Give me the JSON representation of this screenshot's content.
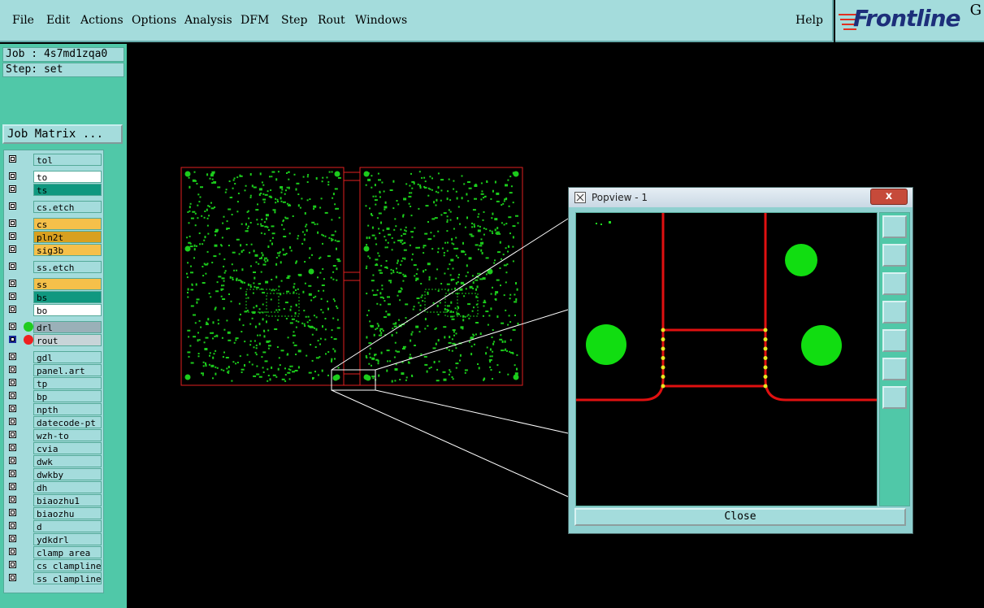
{
  "menu": {
    "items": [
      "File",
      "Edit",
      "Actions",
      "Options",
      "Analysis",
      "DFM",
      "Step",
      "Rout",
      "Windows"
    ],
    "help": "Help"
  },
  "logo": {
    "text": "Frontline",
    "corner": "G"
  },
  "job": {
    "label": "Job : 4s7md1zqa0",
    "step": "Step: set",
    "matrix_button": "Job Matrix ..."
  },
  "layers": [
    {
      "name": "tol",
      "color": "#a4dcdc"
    },
    {
      "name": "to",
      "color": "#ffffff"
    },
    {
      "name": "ts",
      "color": "#109880"
    },
    {
      "name": "cs.etch",
      "color": "#a4dcdc"
    },
    {
      "name": "cs",
      "color": "#f5c04a"
    },
    {
      "name": "pln2t",
      "color": "#d8a020"
    },
    {
      "name": "sig3b",
      "color": "#f5c04a"
    },
    {
      "name": "ss.etch",
      "color": "#a4dcdc"
    },
    {
      "name": "ss",
      "color": "#f5c04a"
    },
    {
      "name": "bs",
      "color": "#109880"
    },
    {
      "name": "bo",
      "color": "#ffffff"
    },
    {
      "name": "drl",
      "color": "#9ab0b8",
      "dot": "#20cc20"
    },
    {
      "name": "rout",
      "color": "#c8d4d8",
      "dot": "#ee2020",
      "active": true
    },
    {
      "name": "gdl",
      "color": "#a4dcdc"
    },
    {
      "name": "panel.art",
      "color": "#a4dcdc"
    },
    {
      "name": "tp",
      "color": "#a4dcdc"
    },
    {
      "name": "bp",
      "color": "#a4dcdc"
    },
    {
      "name": "npth",
      "color": "#a4dcdc"
    },
    {
      "name": "datecode-pt",
      "color": "#a4dcdc"
    },
    {
      "name": "wzh-to",
      "color": "#a4dcdc"
    },
    {
      "name": "cvia",
      "color": "#a4dcdc"
    },
    {
      "name": "dwk",
      "color": "#a4dcdc"
    },
    {
      "name": "dwkby",
      "color": "#a4dcdc"
    },
    {
      "name": "dh",
      "color": "#a4dcdc"
    },
    {
      "name": "biaozhu1",
      "color": "#a4dcdc"
    },
    {
      "name": "biaozhu",
      "color": "#a4dcdc"
    },
    {
      "name": "d",
      "color": "#a4dcdc"
    },
    {
      "name": "ydkdrl",
      "color": "#a4dcdc"
    },
    {
      "name": "clamp_area",
      "color": "#a4dcdc"
    },
    {
      "name": "cs_clampline",
      "color": "#a4dcdc"
    },
    {
      "name": "ss_clampline",
      "color": "#a4dcdc"
    }
  ],
  "popview": {
    "title": "Popview - 1",
    "close_label": "Close",
    "close_x": "x"
  }
}
